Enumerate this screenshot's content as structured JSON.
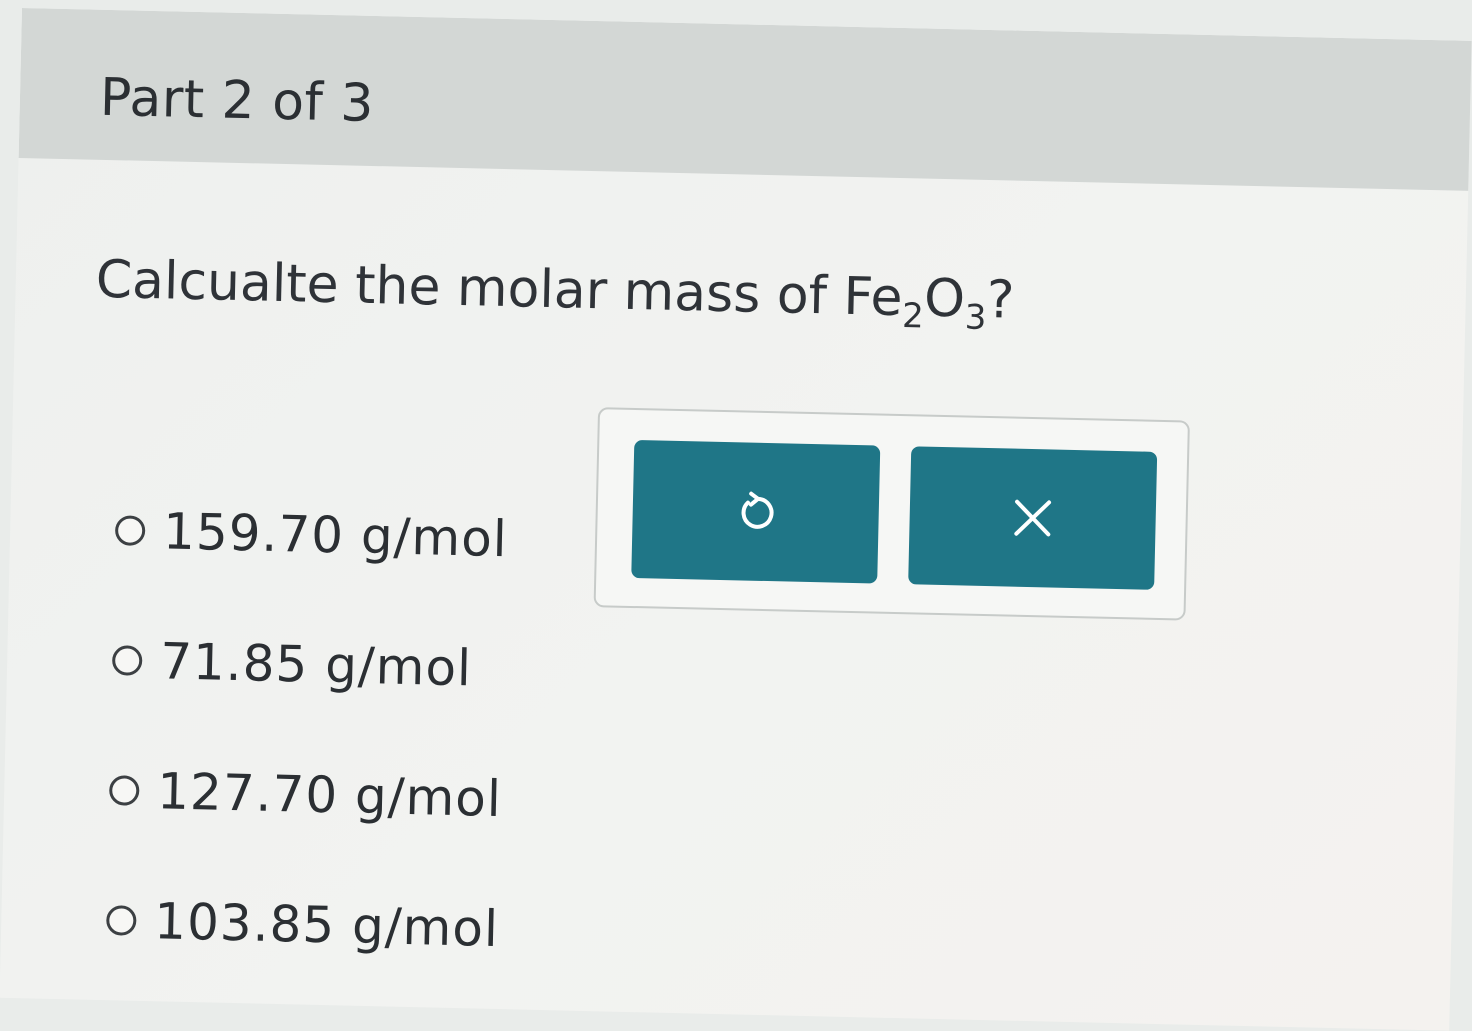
{
  "part": {
    "title": "Part 2 of 3"
  },
  "question": {
    "prefix": "Calcualte the molar mass of ",
    "formula": {
      "el1": "Fe",
      "sub1": "2",
      "el2": "O",
      "sub2": "3"
    },
    "suffix": "?"
  },
  "choices": [
    {
      "label": "159.70 g/mol",
      "selected": false
    },
    {
      "label": "71.85 g/mol",
      "selected": false
    },
    {
      "label": "127.70 g/mol",
      "selected": false
    },
    {
      "label": "103.85 g/mol",
      "selected": false
    }
  ],
  "tools": {
    "undo_icon": "undo-icon",
    "clear_icon": "close-icon"
  },
  "colors": {
    "header_bg": "#d3d7d5",
    "button_bg": "#1f7687",
    "background": "#eef0ee"
  }
}
